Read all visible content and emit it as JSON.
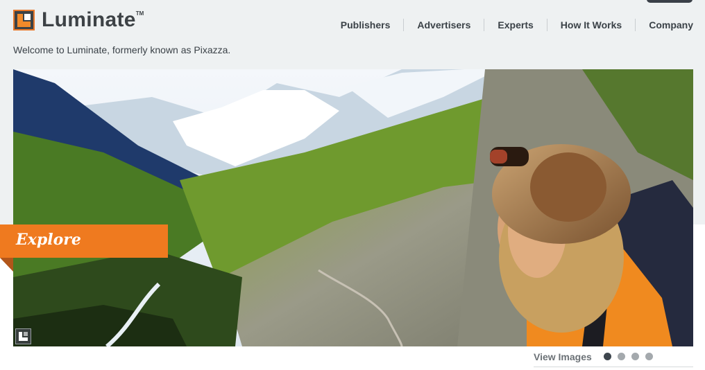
{
  "brand": {
    "name": "Luminate",
    "tm": "TM"
  },
  "nav": {
    "items": [
      {
        "label": "Publishers"
      },
      {
        "label": "Advertisers"
      },
      {
        "label": "Experts"
      },
      {
        "label": "How It Works"
      },
      {
        "label": "Company"
      }
    ]
  },
  "welcome_text": "Welcome to Luminate, formerly known as Pixazza.",
  "hero": {
    "badge_label": "Explore",
    "view_images_label": "View Images",
    "slides": {
      "count": 4,
      "active": 1
    }
  },
  "colors": {
    "accent": "#ef7a1f",
    "text": "#3a4147",
    "band": "#eef1f2"
  }
}
